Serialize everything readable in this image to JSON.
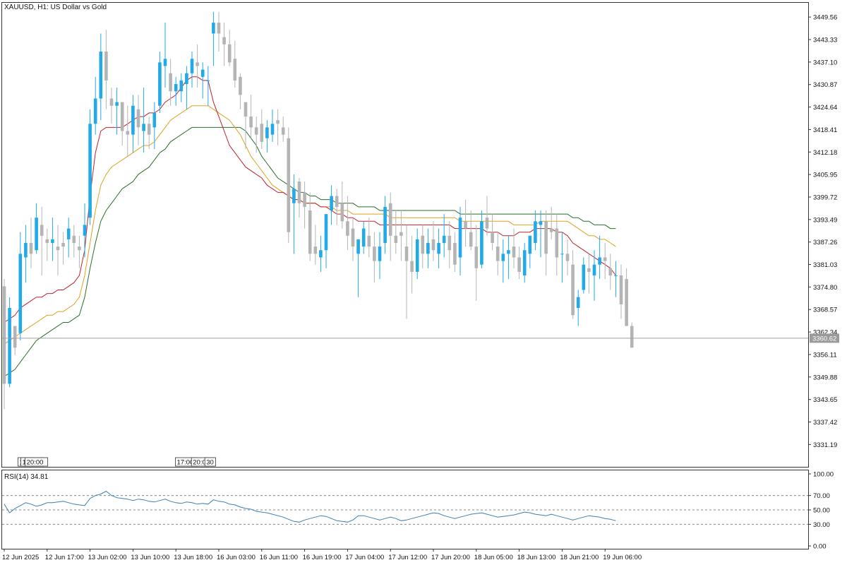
{
  "header": {
    "title": "XAUUSD, H1:  US Dollar vs Gold"
  },
  "rsi_panel": {
    "label": "RSI(14) 34.81"
  },
  "price_tag": "3360.62",
  "annotations": [
    {
      "label": "15:",
      "x": 2.55
    },
    {
      "label": "17:30",
      "x": 3.1
    },
    {
      "label": "20:00",
      "x": 3.9
    },
    {
      "label": "17:00",
      "x": 31.9
    },
    {
      "label": "20:00",
      "x": 34.9
    },
    {
      "label": "30",
      "x": 37.4
    }
  ],
  "colors": {
    "bull": "#21a9e8",
    "bear": "#b4b4b4",
    "ma_fast": "#c0202a",
    "ma_mid": "#e0a020",
    "ma_slow": "#2a6e2a",
    "rsi_line": "#3c7fb3",
    "price_line": "#a0a0a0"
  },
  "chart_data": [
    {
      "type": "candlestick",
      "title": "XAUUSD, H1:  US Dollar vs Gold",
      "ylim": [
        3325,
        3453.5
      ],
      "xlim": [
        -0.5,
        154
      ],
      "yticks": [
        "3449.56",
        "3443.33",
        "3437.10",
        "3430.87",
        "3424.64",
        "3418.41",
        "3412.18",
        "3405.95",
        "3399.72",
        "3393.49",
        "3387.26",
        "3381.03",
        "3374.80",
        "3368.57",
        "3362.34",
        "3356.11",
        "3349.88",
        "3343.65",
        "3337.42",
        "3331.19"
      ],
      "xticks": [
        {
          "label": "12 Jun 2025",
          "x": 0
        },
        {
          "label": "12 Jun 17:00",
          "x": 8
        },
        {
          "label": "13 Jun 02:00",
          "x": 16
        },
        {
          "label": "13 Jun 10:00",
          "x": 24
        },
        {
          "label": "13 Jun 18:00",
          "x": 32
        },
        {
          "label": "16 Jun 03:00",
          "x": 40
        },
        {
          "label": "16 Jun 11:00",
          "x": 48
        },
        {
          "label": "16 Jun 19:00",
          "x": 56
        },
        {
          "label": "17 Jun 04:00",
          "x": 64
        },
        {
          "label": "17 Jun 12:00",
          "x": 72
        },
        {
          "label": "17 Jun 20:00",
          "x": 80
        },
        {
          "label": "18 Jun 05:00",
          "x": 88
        },
        {
          "label": "18 Jun 13:00",
          "x": 96
        },
        {
          "label": "18 Jun 21:00",
          "x": 104
        },
        {
          "label": "19 Jun 06:00",
          "x": 112
        }
      ],
      "current_price": 3360.62,
      "candles": [
        [
          3375,
          3377,
          3341,
          3348
        ],
        [
          3348,
          3372,
          3347,
          3369
        ],
        [
          3364,
          3360,
          3356,
          3358
        ],
        [
          3362,
          3390,
          3360,
          3384
        ],
        [
          3383,
          3392,
          3376,
          3387
        ],
        [
          3387,
          3394,
          3380,
          3384
        ],
        [
          3385,
          3398,
          3384,
          3394
        ],
        [
          3392,
          3397,
          3378,
          3389
        ],
        [
          3388,
          3391,
          3382,
          3387
        ],
        [
          3387,
          3394,
          3382,
          3388
        ],
        [
          3386,
          3392,
          3378,
          3385
        ],
        [
          3387,
          3390,
          3381,
          3386
        ],
        [
          3388,
          3394,
          3383,
          3391
        ],
        [
          3389,
          3392,
          3383,
          3387
        ],
        [
          3386,
          3389,
          3380,
          3385
        ],
        [
          3389,
          3398,
          3383,
          3392
        ],
        [
          3394,
          3424,
          3392,
          3420
        ],
        [
          3420,
          3433,
          3417,
          3427
        ],
        [
          3427,
          3445,
          3421,
          3440
        ],
        [
          3440,
          3446,
          3424,
          3432
        ],
        [
          3427,
          3430,
          3420,
          3425
        ],
        [
          3425,
          3430,
          3417,
          3426
        ],
        [
          3426,
          3426,
          3414,
          3418
        ],
        [
          3418,
          3425,
          3411,
          3417
        ],
        [
          3417,
          3428,
          3412,
          3425
        ],
        [
          3424,
          3428,
          3414,
          3419
        ],
        [
          3418,
          3430,
          3412,
          3420
        ],
        [
          3420,
          3422,
          3413,
          3417
        ],
        [
          3419,
          3426,
          3413,
          3423
        ],
        [
          3425,
          3440,
          3423,
          3437
        ],
        [
          3436,
          3448,
          3430,
          3438
        ],
        [
          3434,
          3438,
          3425,
          3429
        ],
        [
          3429,
          3433,
          3425,
          3431
        ],
        [
          3429,
          3434,
          3426,
          3432
        ],
        [
          3431,
          3436,
          3424,
          3434
        ],
        [
          3434,
          3440,
          3430,
          3438
        ],
        [
          3437,
          3442,
          3430,
          3436
        ],
        [
          3433,
          3437,
          3427,
          3435
        ],
        [
          3432,
          3436,
          3425,
          3432
        ],
        [
          3445,
          3451,
          3436,
          3448
        ],
        [
          3448,
          3451,
          3440,
          3445
        ],
        [
          3444,
          3448,
          3436,
          3442
        ],
        [
          3442,
          3446,
          3436,
          3437
        ],
        [
          3438,
          3443,
          3430,
          3432
        ],
        [
          3433,
          3434,
          3424,
          3428
        ],
        [
          3426,
          3426,
          3413,
          3422
        ],
        [
          3422,
          3428,
          3416,
          3419
        ],
        [
          3419,
          3422,
          3412,
          3417
        ],
        [
          3420,
          3424,
          3413,
          3415
        ],
        [
          3416,
          3421,
          3412,
          3419
        ],
        [
          3417,
          3424,
          3415,
          3420
        ],
        [
          3421,
          3424,
          3414,
          3420
        ],
        [
          3419,
          3422,
          3415,
          3417
        ],
        [
          3416,
          3419,
          3387,
          3390
        ],
        [
          3398,
          3406,
          3384,
          3402
        ],
        [
          3404,
          3405,
          3394,
          3398
        ],
        [
          3401,
          3404,
          3391,
          3397
        ],
        [
          3396,
          3401,
          3382,
          3384
        ],
        [
          3386,
          3392,
          3381,
          3384
        ],
        [
          3383,
          3389,
          3379,
          3385
        ],
        [
          3385,
          3392,
          3380,
          3395
        ],
        [
          3396,
          3403,
          3392,
          3400
        ],
        [
          3400,
          3402,
          3392,
          3397
        ],
        [
          3398,
          3404,
          3391,
          3393
        ],
        [
          3393,
          3400,
          3385,
          3389
        ],
        [
          3391,
          3394,
          3382,
          3386
        ],
        [
          3384,
          3388,
          3372,
          3388
        ],
        [
          3386,
          3393,
          3384,
          3391
        ],
        [
          3389,
          3394,
          3383,
          3386
        ],
        [
          3386,
          3390,
          3376,
          3382
        ],
        [
          3382,
          3390,
          3377,
          3386
        ],
        [
          3387,
          3400,
          3384,
          3397
        ],
        [
          3398,
          3401,
          3382,
          3389
        ],
        [
          3389,
          3396,
          3384,
          3387
        ],
        [
          3390,
          3396,
          3382,
          3389
        ],
        [
          3386,
          3392,
          3366,
          3382
        ],
        [
          3382,
          3389,
          3373,
          3379
        ],
        [
          3379,
          3391,
          3377,
          3388
        ],
        [
          3389,
          3392,
          3380,
          3384
        ],
        [
          3384,
          3391,
          3380,
          3387
        ],
        [
          3388,
          3393,
          3382,
          3385
        ],
        [
          3384,
          3391,
          3380,
          3387
        ],
        [
          3387,
          3395,
          3383,
          3389
        ],
        [
          3389,
          3393,
          3380,
          3385
        ],
        [
          3387,
          3390,
          3379,
          3381
        ],
        [
          3383,
          3397,
          3378,
          3394
        ],
        [
          3393,
          3399,
          3386,
          3391
        ],
        [
          3390,
          3396,
          3385,
          3386
        ],
        [
          3386,
          3392,
          3371,
          3380
        ],
        [
          3381,
          3396,
          3380,
          3393
        ],
        [
          3394,
          3400,
          3389,
          3391
        ],
        [
          3390,
          3395,
          3385,
          3387
        ],
        [
          3386,
          3390,
          3378,
          3382
        ],
        [
          3382,
          3388,
          3376,
          3384
        ],
        [
          3384,
          3389,
          3377,
          3385
        ],
        [
          3386,
          3391,
          3380,
          3383
        ],
        [
          3383,
          3386,
          3377,
          3379
        ],
        [
          3378,
          3387,
          3376,
          3385
        ],
        [
          3384,
          3389,
          3380,
          3389
        ],
        [
          3387,
          3396,
          3385,
          3393
        ],
        [
          3392,
          3396,
          3383,
          3393
        ],
        [
          3393,
          3396,
          3378,
          3384
        ],
        [
          3391,
          3397,
          3388,
          3390
        ],
        [
          3391,
          3395,
          3378,
          3383
        ],
        [
          3384,
          3390,
          3376,
          3384
        ],
        [
          3384,
          3388,
          3378,
          3382
        ],
        [
          3381,
          3385,
          3366,
          3367
        ],
        [
          3369,
          3374,
          3364,
          3372
        ],
        [
          3374,
          3383,
          3373,
          3381
        ],
        [
          3380,
          3384,
          3373,
          3379
        ],
        [
          3378,
          3385,
          3371,
          3381
        ],
        [
          3381,
          3389,
          3377,
          3383
        ],
        [
          3383,
          3387,
          3377,
          3382
        ],
        [
          3380,
          3384,
          3374,
          3378
        ],
        [
          3378,
          3382,
          3372,
          3378
        ],
        [
          3378,
          3381,
          3366,
          3370
        ],
        [
          3377,
          3380,
          3364,
          3364
        ],
        [
          3364,
          3365,
          3359,
          3358
        ]
      ],
      "ma_fast": [
        3365,
        3366,
        3367,
        3369,
        3370,
        3371,
        3372,
        3372,
        3373,
        3373,
        3374,
        3374,
        3375,
        3376,
        3378,
        3385,
        3400,
        3412,
        3418,
        3419,
        3419,
        3419,
        3419,
        3420,
        3421,
        3422,
        3422,
        3423,
        3423,
        3424,
        3426,
        3427,
        3428,
        3430,
        3432,
        3433,
        3433,
        3432,
        3432,
        3426,
        3422,
        3418,
        3414,
        3412,
        3410,
        3408,
        3407,
        3406,
        3405,
        3403,
        3402,
        3401,
        3401,
        3400,
        3399,
        3399,
        3398,
        3398,
        3398,
        3397,
        3397,
        3396,
        3395,
        3395,
        3394,
        3394,
        3393,
        3393,
        3393,
        3393,
        3392,
        3392,
        3392,
        3392,
        3392,
        3392,
        3392,
        3392,
        3392,
        3392,
        3392,
        3392,
        3392,
        3392,
        3391,
        3391,
        3391,
        3391,
        3391,
        3391,
        3390,
        3390,
        3390,
        3389,
        3389,
        3389,
        3390,
        3390,
        3390,
        3391,
        3391,
        3391,
        3391,
        3390,
        3390,
        3389,
        3387,
        3386,
        3385,
        3384,
        3383,
        3382,
        3381,
        3380,
        3378
      ],
      "ma_mid": [
        3359,
        3360,
        3361,
        3362,
        3363,
        3364,
        3365,
        3366,
        3367,
        3367,
        3368,
        3368,
        3369,
        3370,
        3372,
        3378,
        3387,
        3396,
        3403,
        3406,
        3408,
        3409,
        3410,
        3411,
        3412,
        3413,
        3414,
        3414,
        3415,
        3417,
        3419,
        3421,
        3422,
        3423,
        3424,
        3425,
        3425,
        3425,
        3425,
        3424,
        3423,
        3422,
        3421,
        3419,
        3417,
        3414,
        3411,
        3409,
        3407,
        3405,
        3403,
        3402,
        3401,
        3400,
        3399,
        3399,
        3398,
        3398,
        3398,
        3397,
        3397,
        3397,
        3396,
        3396,
        3396,
        3395,
        3395,
        3395,
        3395,
        3395,
        3395,
        3395,
        3394,
        3394,
        3394,
        3394,
        3394,
        3394,
        3394,
        3394,
        3394,
        3394,
        3394,
        3394,
        3394,
        3393,
        3393,
        3393,
        3393,
        3393,
        3393,
        3393,
        3393,
        3393,
        3393,
        3392,
        3392,
        3392,
        3392,
        3392,
        3393,
        3393,
        3393,
        3393,
        3393,
        3393,
        3392,
        3391,
        3390,
        3389,
        3389,
        3388,
        3388,
        3387,
        3386
      ],
      "ma_slow": [
        3350,
        3351,
        3352,
        3354,
        3356,
        3358,
        3360,
        3361,
        3362,
        3363,
        3364,
        3365,
        3365,
        3366,
        3367,
        3372,
        3380,
        3387,
        3393,
        3396,
        3398,
        3400,
        3402,
        3403,
        3404,
        3406,
        3407,
        3408,
        3410,
        3412,
        3413,
        3415,
        3416,
        3417,
        3418,
        3419,
        3419,
        3419,
        3419,
        3419,
        3419,
        3419,
        3419,
        3419,
        3419,
        3418,
        3416,
        3414,
        3411,
        3409,
        3407,
        3405,
        3404,
        3403,
        3402,
        3401,
        3401,
        3400,
        3400,
        3399,
        3399,
        3399,
        3398,
        3398,
        3398,
        3398,
        3397,
        3397,
        3397,
        3397,
        3396,
        3396,
        3396,
        3396,
        3396,
        3396,
        3396,
        3396,
        3396,
        3396,
        3396,
        3396,
        3396,
        3396,
        3396,
        3395,
        3395,
        3395,
        3395,
        3395,
        3395,
        3395,
        3395,
        3395,
        3395,
        3395,
        3395,
        3395,
        3395,
        3395,
        3395,
        3395,
        3395,
        3395,
        3395,
        3395,
        3394,
        3394,
        3393,
        3393,
        3392,
        3392,
        3392,
        3391,
        3391
      ]
    },
    {
      "type": "line",
      "title": "RSI(14) 34.81",
      "ylim": [
        0,
        100
      ],
      "yticks": [
        "100.00",
        "70.00",
        "50.00",
        "30.00",
        "0.00"
      ],
      "levels": [
        70,
        50,
        30
      ],
      "values": [
        58,
        46,
        52,
        56,
        60,
        58,
        55,
        57,
        60,
        60,
        61,
        62,
        60,
        58,
        57,
        56,
        66,
        70,
        72,
        76,
        70,
        67,
        66,
        65,
        63,
        65,
        64,
        62,
        61,
        63,
        65,
        62,
        60,
        59,
        61,
        60,
        58,
        59,
        58,
        64,
        62,
        61,
        58,
        57,
        54,
        52,
        51,
        48,
        47,
        46,
        44,
        42,
        40,
        37,
        34,
        33,
        36,
        38,
        40,
        42,
        41,
        38,
        35,
        34,
        33,
        36,
        42,
        42,
        40,
        38,
        36,
        38,
        40,
        38,
        35,
        36,
        38,
        40,
        42,
        44,
        46,
        45,
        42,
        40,
        38,
        40,
        42,
        44,
        45,
        46,
        44,
        42,
        40,
        41,
        42,
        43,
        45,
        47,
        46,
        44,
        43,
        42,
        44,
        42,
        40,
        38,
        36,
        38,
        40,
        42,
        41,
        40,
        38,
        37,
        35
      ],
      "line_color": "#3c7fb3"
    }
  ]
}
